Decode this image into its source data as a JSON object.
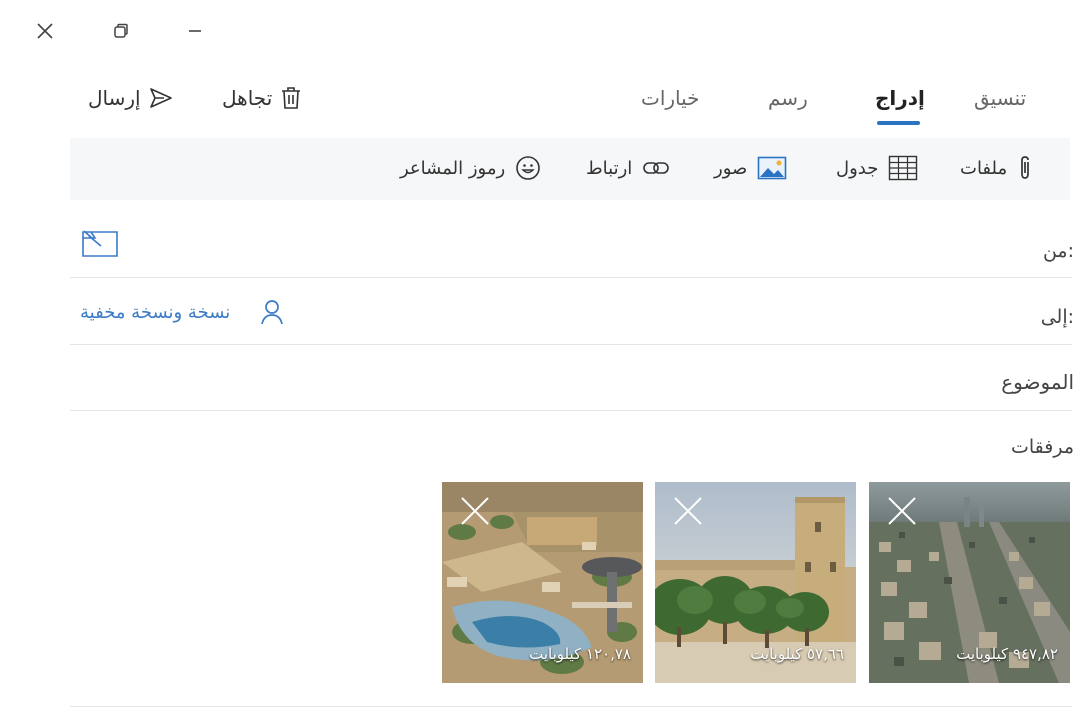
{
  "window": {
    "close_icon": "close-icon",
    "restore_icon": "restore-icon",
    "minimize_icon": "minimize-icon"
  },
  "commands": {
    "send_label": "إرسال",
    "discard_label": "تجاهل"
  },
  "tabs": [
    {
      "label": "تنسيق",
      "active": false
    },
    {
      "label": "إدراج",
      "active": true
    },
    {
      "label": "رسم",
      "active": false
    },
    {
      "label": "خيارات",
      "active": false
    }
  ],
  "ribbon": {
    "files": "ملفات",
    "table": "جدول",
    "pictures": "صور",
    "link": "ارتباط",
    "emoji": "رموز المشاعر"
  },
  "fields": {
    "from_label": "من:",
    "to_label": "إلى:",
    "cc_bcc_label": "نسخة ونسخة مخفية",
    "subject_placeholder": "الموضوع",
    "attachments_label": "مرفقات"
  },
  "attachments": [
    {
      "size": "٩٤٧,٨٢ كيلوبايت"
    },
    {
      "size": "٥٧,٦٦ كيلوبايت"
    },
    {
      "size": "١٢٠,٧٨ كيلوبايت"
    }
  ],
  "colors": {
    "accent": "#2b73c3",
    "link": "#3a7bc7",
    "ribbon_bg": "#f6f7f8"
  }
}
